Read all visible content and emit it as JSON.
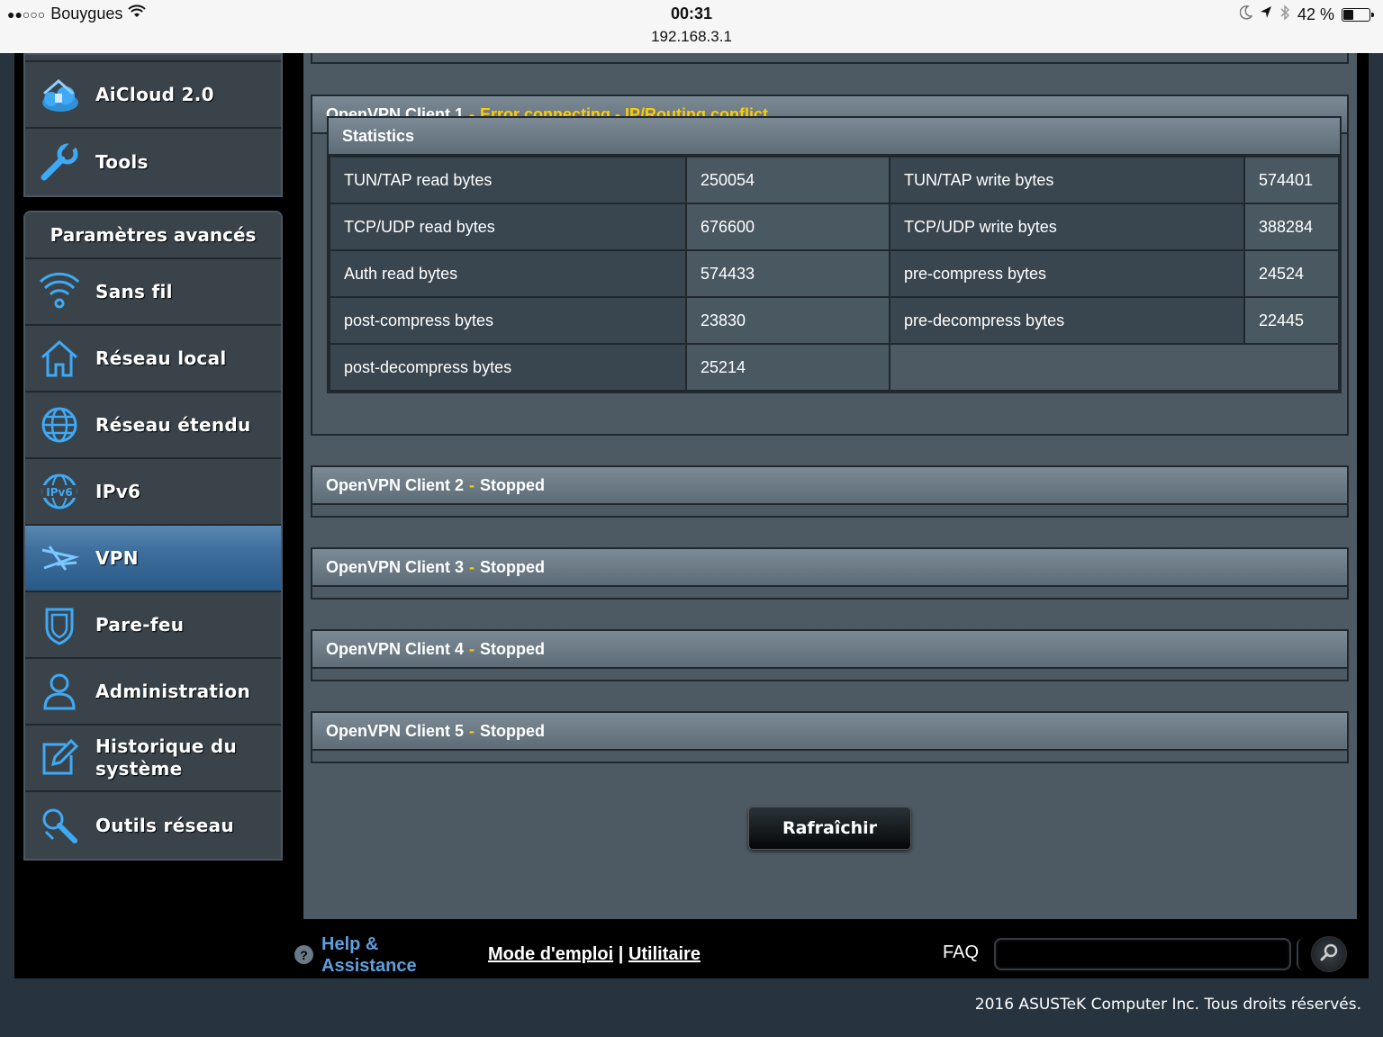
{
  "status_bar": {
    "signal": "●●○○○",
    "carrier": "Bouygues",
    "time": "00:31",
    "url": "192.168.3.1",
    "battery_text": "42 %",
    "battery_level": 0.42
  },
  "sidebar": {
    "top_items": [
      {
        "label": "AiCloud 2.0",
        "icon": "cloud-home-icon"
      },
      {
        "label": "Tools",
        "icon": "wrench-icon"
      }
    ],
    "section_title": "Paramètres avancés",
    "items": [
      {
        "label": "Sans fil",
        "icon": "wifi-icon"
      },
      {
        "label": "Réseau local",
        "icon": "home-icon"
      },
      {
        "label": "Réseau étendu",
        "icon": "globe-icon"
      },
      {
        "label": "IPv6",
        "icon": "ipv6-globe-icon"
      },
      {
        "label": "VPN",
        "icon": "vpn-icon",
        "active": true
      },
      {
        "label": "Pare-feu",
        "icon": "shield-icon"
      },
      {
        "label": "Administration",
        "icon": "user-icon"
      },
      {
        "label": "Historique du système",
        "icon": "edit-log-icon"
      },
      {
        "label": "Outils réseau",
        "icon": "network-tools-icon"
      }
    ]
  },
  "clients": [
    {
      "name": "OpenVPN Client 1",
      "separator": "-",
      "status": "Error connecting - IP/Routing conflict",
      "error": true
    },
    {
      "name": "OpenVPN Client 2",
      "separator": "-",
      "status": "Stopped"
    },
    {
      "name": "OpenVPN Client 3",
      "separator": "-",
      "status": "Stopped"
    },
    {
      "name": "OpenVPN Client 4",
      "separator": "-",
      "status": "Stopped"
    },
    {
      "name": "OpenVPN Client 5",
      "separator": "-",
      "status": "Stopped"
    }
  ],
  "statistics": {
    "title": "Statistics",
    "rows": [
      {
        "k1": "TUN/TAP read bytes",
        "v1": "250054",
        "k2": "TUN/TAP write bytes",
        "v2": "574401"
      },
      {
        "k1": "TCP/UDP read bytes",
        "v1": "676600",
        "k2": "TCP/UDP write bytes",
        "v2": "388284"
      },
      {
        "k1": "Auth read bytes",
        "v1": "574433",
        "k2": "pre-compress bytes",
        "v2": "24524"
      },
      {
        "k1": "post-compress bytes",
        "v1": "23830",
        "k2": "pre-decompress bytes",
        "v2": "22445"
      },
      {
        "k1": "post-decompress bytes",
        "v1": "25214",
        "k2": "",
        "v2": ""
      }
    ]
  },
  "refresh_label": "Rafraîchir",
  "footer": {
    "help_label": "Help & Assistance",
    "manual_label": "Mode d'emploi",
    "divider": "|",
    "utility_label": "Utilitaire",
    "faq_label": "FAQ",
    "copyright": "2016 ASUSTeK Computer Inc. Tous droits réservés."
  },
  "colors": {
    "accent_active": "#3d6e9c",
    "status_error": "#ffcc00",
    "icon_blue": "#3fa9f5"
  }
}
